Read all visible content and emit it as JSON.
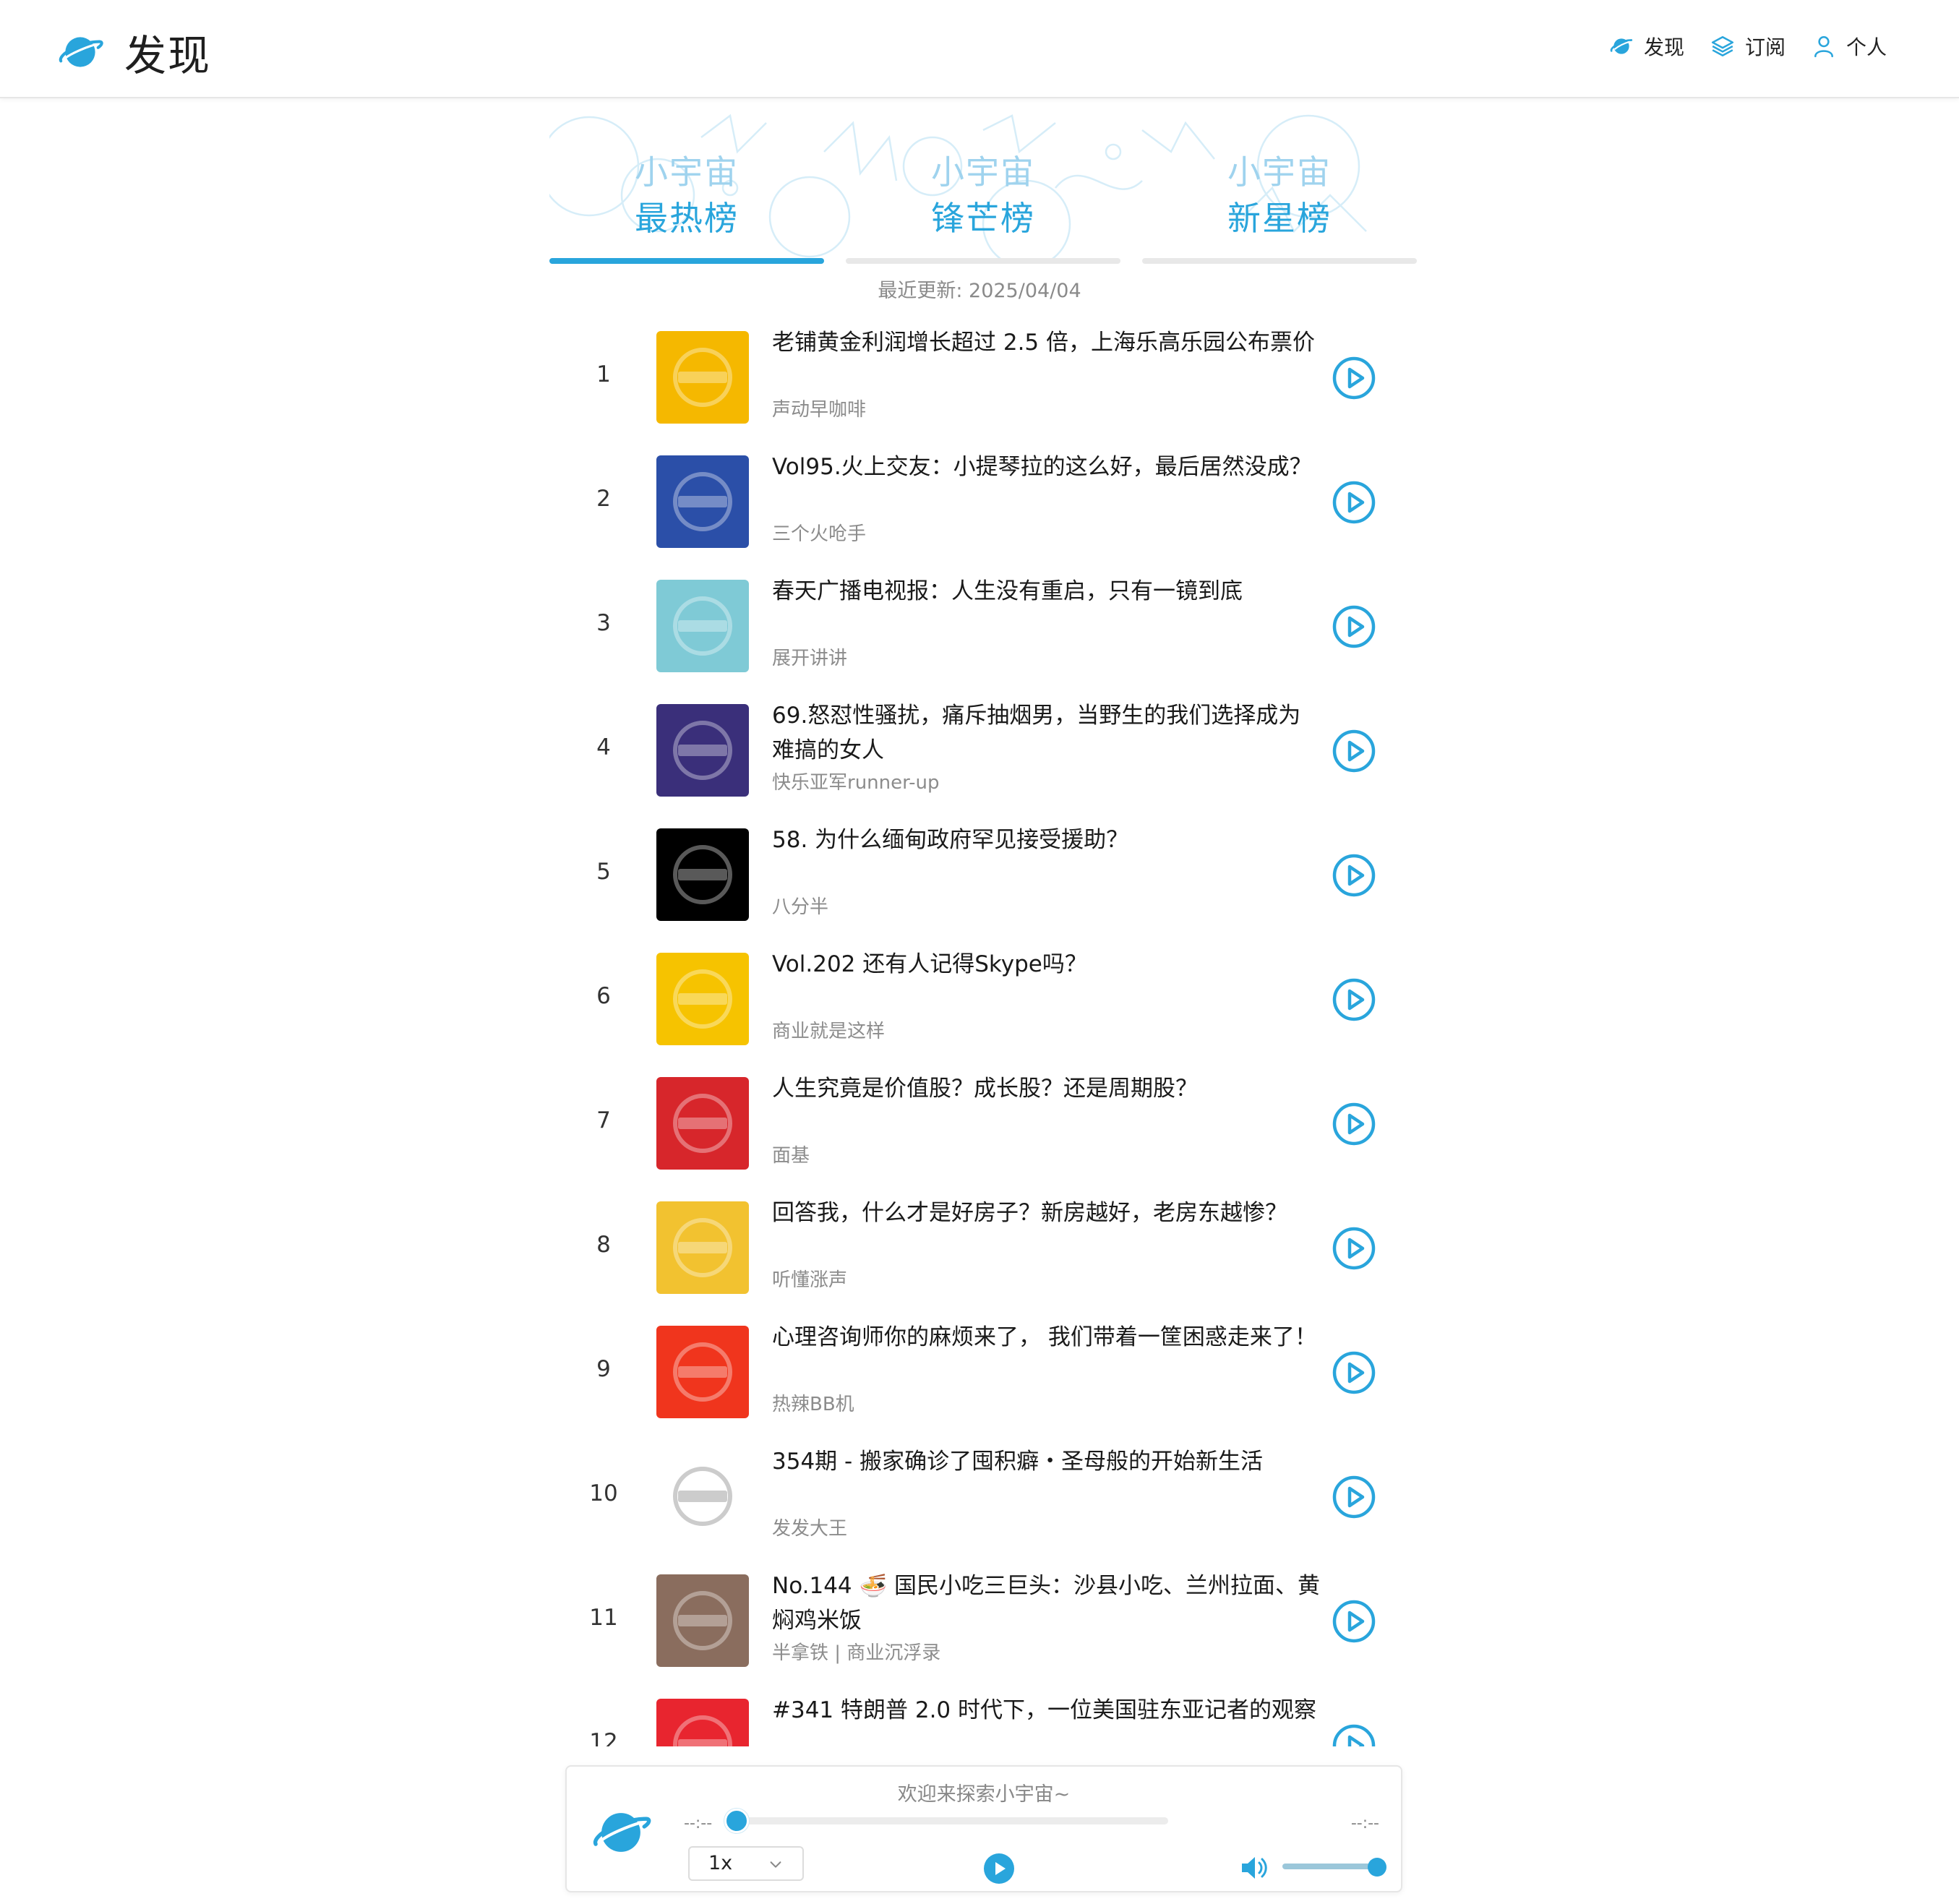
{
  "header": {
    "title": "发现",
    "nav": [
      {
        "label": "发现",
        "icon": "planet-icon"
      },
      {
        "label": "订阅",
        "icon": "layers-icon"
      },
      {
        "label": "个人",
        "icon": "user-icon"
      }
    ]
  },
  "tabs": [
    {
      "line1": "小宇宙",
      "line2": "最热榜",
      "active": true
    },
    {
      "line1": "小宇宙",
      "line2": "锋芒榜",
      "active": false
    },
    {
      "line1": "小宇宙",
      "line2": "新星榜",
      "active": false
    }
  ],
  "updated": "最近更新: 2025/04/04",
  "episodes": [
    {
      "rank": "1",
      "title": "老铺黄金利润增长超过 2.5 倍，上海乐高乐园公布票价",
      "podcast": "声动早咖啡",
      "cover_color": "#f5b800"
    },
    {
      "rank": "2",
      "title": "Vol95.火上交友：小提琴拉的这么好，最后居然没成？",
      "podcast": "三个火呛手",
      "cover_color": "#2b4fa8"
    },
    {
      "rank": "3",
      "title": "春天广播电视报：人生没有重启，只有一镜到底",
      "podcast": "展开讲讲",
      "cover_color": "#7fcad6"
    },
    {
      "rank": "4",
      "title": "69.怒怼性骚扰，痛斥抽烟男，当野生的我们选择成为难搞的女人",
      "podcast": "快乐亚军runner-up",
      "cover_color": "#3a2f7a"
    },
    {
      "rank": "5",
      "title": "58. 为什么缅甸政府罕见接受援助？",
      "podcast": "八分半",
      "cover_color": "#000000"
    },
    {
      "rank": "6",
      "title": "Vol.202 还有人记得Skype吗？",
      "podcast": "商业就是这样",
      "cover_color": "#f6c300"
    },
    {
      "rank": "7",
      "title": "人生究竟是价值股？成长股？还是周期股？",
      "podcast": "面基",
      "cover_color": "#d7262b"
    },
    {
      "rank": "8",
      "title": "回答我，什么才是好房子？新房越好，老房东越惨？",
      "podcast": "听懂涨声",
      "cover_color": "#f2c230"
    },
    {
      "rank": "9",
      "title": "心理咨询师你的麻烦来了， 我们带着一筐困惑走来了！",
      "podcast": "热辣BB机",
      "cover_color": "#f0351d"
    },
    {
      "rank": "10",
      "title": "354期 - 搬家确诊了囤积癖・圣母般的开始新生活",
      "podcast": "发发大王",
      "cover_color": "#ffffff"
    },
    {
      "rank": "11",
      "title": "No.144 🍜 国民小吃三巨头：沙县小吃、兰州拉面、黄焖鸡米饭",
      "podcast": "半拿铁 | 商业沉浮录",
      "cover_color": "#8a6d5e"
    },
    {
      "rank": "12",
      "title": "#341 特朗普 2.0 时代下，一位美国驻东亚记者的观察",
      "podcast": "",
      "cover_color": "#e8252f"
    }
  ],
  "player": {
    "message": "欢迎来探索小宇宙~",
    "current_time": "--:--",
    "duration": "--:--",
    "progress": 0,
    "speed": "1x",
    "volume": 1.0
  },
  "colors": {
    "accent": "#29a5dc",
    "tab_light": "#9fd3ee"
  }
}
